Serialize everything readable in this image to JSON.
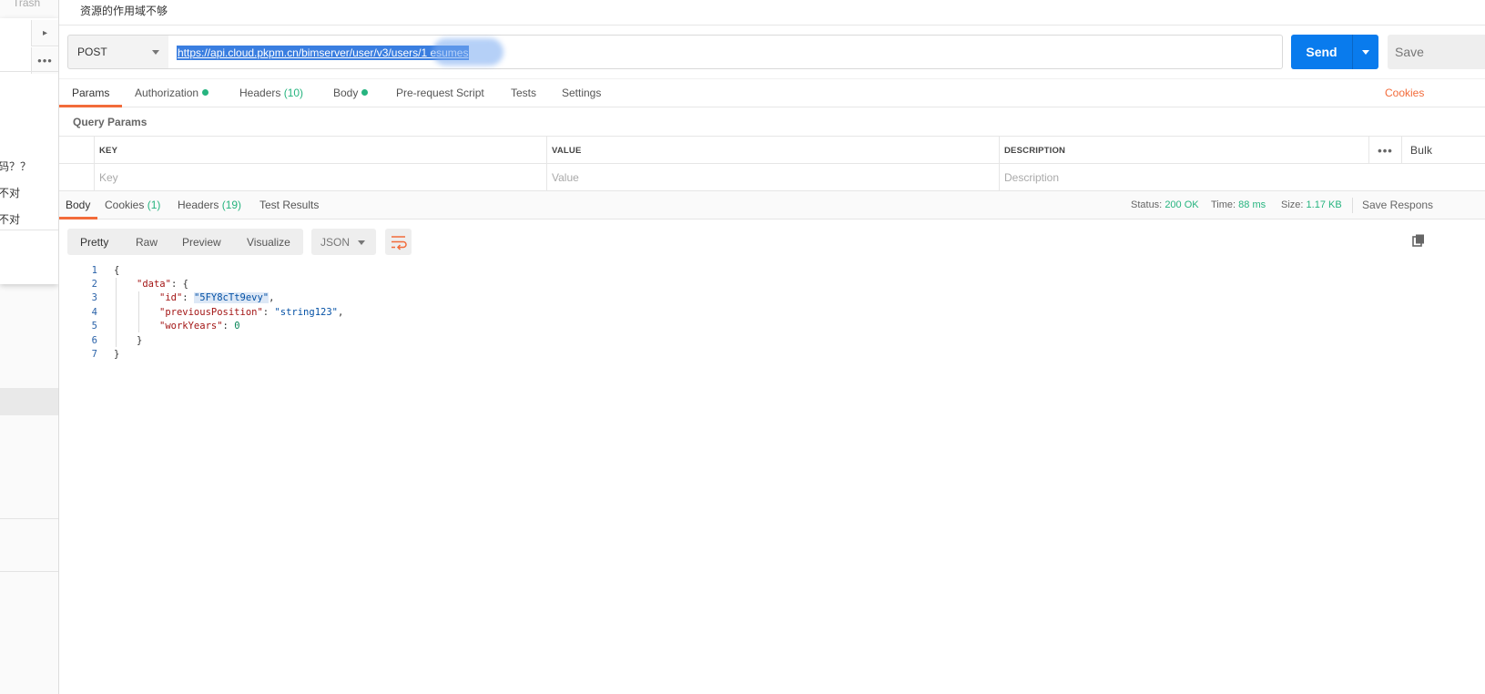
{
  "sidebar": {
    "trash_label": "Trash",
    "snippets": [
      "码？？",
      "不对",
      "x不对"
    ]
  },
  "request": {
    "name": "资源的作用域不够",
    "method": "POST",
    "url": "https://api.cloud.pkpm.cn/bimserver/user/v3/users/1            esumes",
    "send_label": "Send",
    "save_label": "Save"
  },
  "request_tabs": {
    "params": "Params",
    "authorization": "Authorization",
    "headers": "Headers",
    "headers_count": "(10)",
    "body": "Body",
    "prerequest": "Pre-request Script",
    "tests": "Tests",
    "settings": "Settings",
    "cookies": "Cookies"
  },
  "query_params": {
    "title": "Query Params",
    "columns": [
      "KEY",
      "VALUE",
      "DESCRIPTION"
    ],
    "placeholders": [
      "Key",
      "Value",
      "Description"
    ],
    "bulk_edit": "Bulk"
  },
  "response_tabs": {
    "body": "Body",
    "cookies": "Cookies",
    "cookies_count": "(1)",
    "headers": "Headers",
    "headers_count": "(19)",
    "test_results": "Test Results"
  },
  "response_meta": {
    "status_label": "Status:",
    "status_value": "200 OK",
    "time_label": "Time:",
    "time_value": "88 ms",
    "size_label": "Size:",
    "size_value": "1.17 KB",
    "save_response": "Save Respons"
  },
  "response_toolbar": {
    "formats": [
      "Pretty",
      "Raw",
      "Preview",
      "Visualize"
    ],
    "language": "JSON"
  },
  "response_body": {
    "line_numbers": [
      "1",
      "2",
      "3",
      "4",
      "5",
      "6",
      "7"
    ],
    "tokens": {
      "open_brace": "{",
      "data_key": "\"data\"",
      "colon_open": ": {",
      "id_key": "\"id\"",
      "id_value": "\"5FY8cTt9evy\"",
      "prev_key": "\"previousPosition\"",
      "prev_value": "\"string123\"",
      "work_key": "\"workYears\"",
      "work_value": "0",
      "inner_close": "}",
      "outer_close": "}",
      "sep": ": ",
      "comma": ","
    }
  },
  "colors": {
    "accent_orange": "#f26b3a",
    "send_blue": "#097bed",
    "ok_green": "#26b47f"
  }
}
